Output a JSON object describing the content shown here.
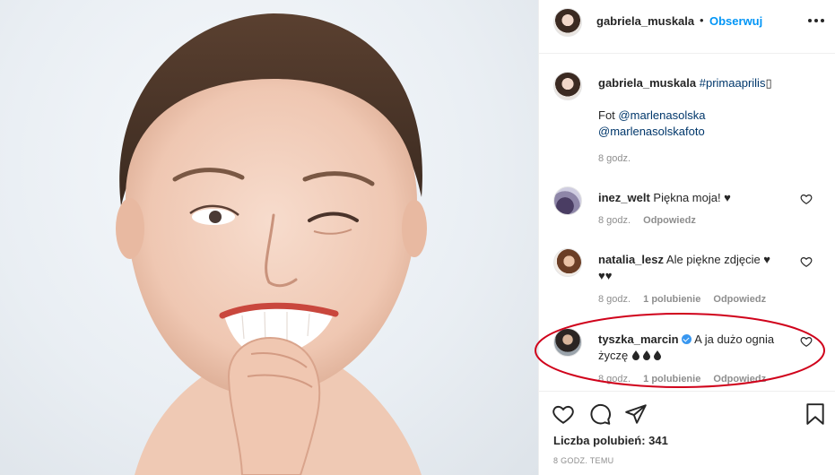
{
  "post": {
    "author": "gabriela_muskala",
    "follow_label": "Obserwuj",
    "separator": "•"
  },
  "caption": {
    "user": "gabriela_muskala",
    "hashtag": "#primaaprilis",
    "emoji_box": "▯",
    "fot_label": "Fot",
    "mention_1": "@marlenasolska",
    "mention_2": "@marlenasolskafoto",
    "time": "8 godz."
  },
  "comments": [
    {
      "user": "inez_welt",
      "text": "Piękna moja! ♥",
      "time": "8 godz.",
      "likes": "",
      "reply": "Odpowiedz"
    },
    {
      "user": "natalia_lesz",
      "text": "Ale piękne zdjęcie ♥",
      "text2": "♥♥",
      "time": "8 godz.",
      "likes": "1 polubienie",
      "reply": "Odpowiedz"
    },
    {
      "user": "tyszka_marcin",
      "text": "A ja dużo ognia",
      "text2": "życzę",
      "time": "8 godz.",
      "likes": "1 polubienie",
      "reply": "Odpowiedz"
    }
  ],
  "footer": {
    "likes_label": "Liczba polubień: 341",
    "timestamp": "8 GODZ. TEMU"
  },
  "colors": {
    "accent": "#0095f6",
    "highlight_oval": "#d0021b",
    "meta_text": "#8e8e8e"
  },
  "icons": [
    "more-icon",
    "heart-icon",
    "comment-icon",
    "share-icon",
    "bookmark-icon",
    "verified-icon",
    "fire-icon"
  ]
}
